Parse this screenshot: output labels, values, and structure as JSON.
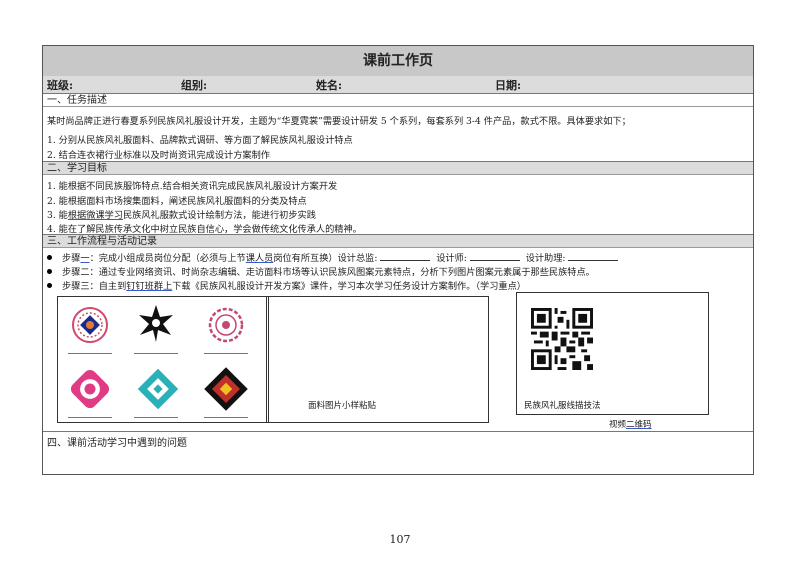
{
  "header": {
    "title": "课前工作页",
    "class_label": "班级:",
    "group_label": "组别:",
    "name_label": "姓名:",
    "date_label": "日期:"
  },
  "task": {
    "heading": "一、任务描述",
    "intro": "某时尚品牌正进行春夏系列民族风礼服设计开发，主题为“华夏霓裳”需要设计研发 5 个系列，每套系列 3-4 件产品，款式不限。具体要求如下；",
    "items": [
      "1. 分别从民族风礼服面料、品牌款式调研、等方面了解民族风礼服设计特点",
      "2. 结合连衣裙行业标准以及时尚资讯完成设计方案制作"
    ]
  },
  "goals": {
    "heading": "二、学习目标",
    "items": [
      "1. 能根据不同民族服饰特点.结合相关资讯完成民族风礼服设计方案开发",
      "2. 能根据面料市场搜集面料，阐述民族风礼服面料的分类及特点",
      "3. 能根据微课学习民族风礼服款式设计绘制方法，能进行初步实践",
      "4. 能在了解民族传承文化中树立民族自信心，学会做传统文化传承人的精神。"
    ],
    "item3_prefix": "3. 能",
    "item3_link": "根据微课学习",
    "item3_suffix": "民族风礼服款式设计绘制方法，能进行初步实践"
  },
  "process": {
    "heading": "三、工作流程与活动记录",
    "step1_a": "步骤",
    "step1_b": "一",
    "step1_c": "：完成小组成员岗位分配（必须与上节",
    "step1_d": "课人员",
    "step1_e": "岗位有所互换）设计总监:",
    "step1_f": "设计师:",
    "step1_g": "设计助理:",
    "step2": "步骤二：通过专业网络资讯、时尚杂志编辑、走访面料市场等认识民族风图案元素特点，分析下列图片图案元素属于那些民族特点。",
    "step3_a": "步骤三：自主到",
    "step3_b": "钉钉班群上",
    "step3_c": "下载《民族风礼服设计开发方案》课件，学习本次学习任务设计方案制作。（学习重点）",
    "fabric_caption": "面料图片小样粘贴",
    "qr_caption": "民族风礼服线描技法",
    "video_label": "视频",
    "video_link": "二维码"
  },
  "problems": {
    "heading": "四、课前活动学习中遇到的问题"
  },
  "footer": {
    "page_number": "107"
  },
  "colors": {
    "title_bg": "#c8c8c8",
    "section_bg": "#dcdcdc",
    "link_underline": "#3a5bc7"
  }
}
